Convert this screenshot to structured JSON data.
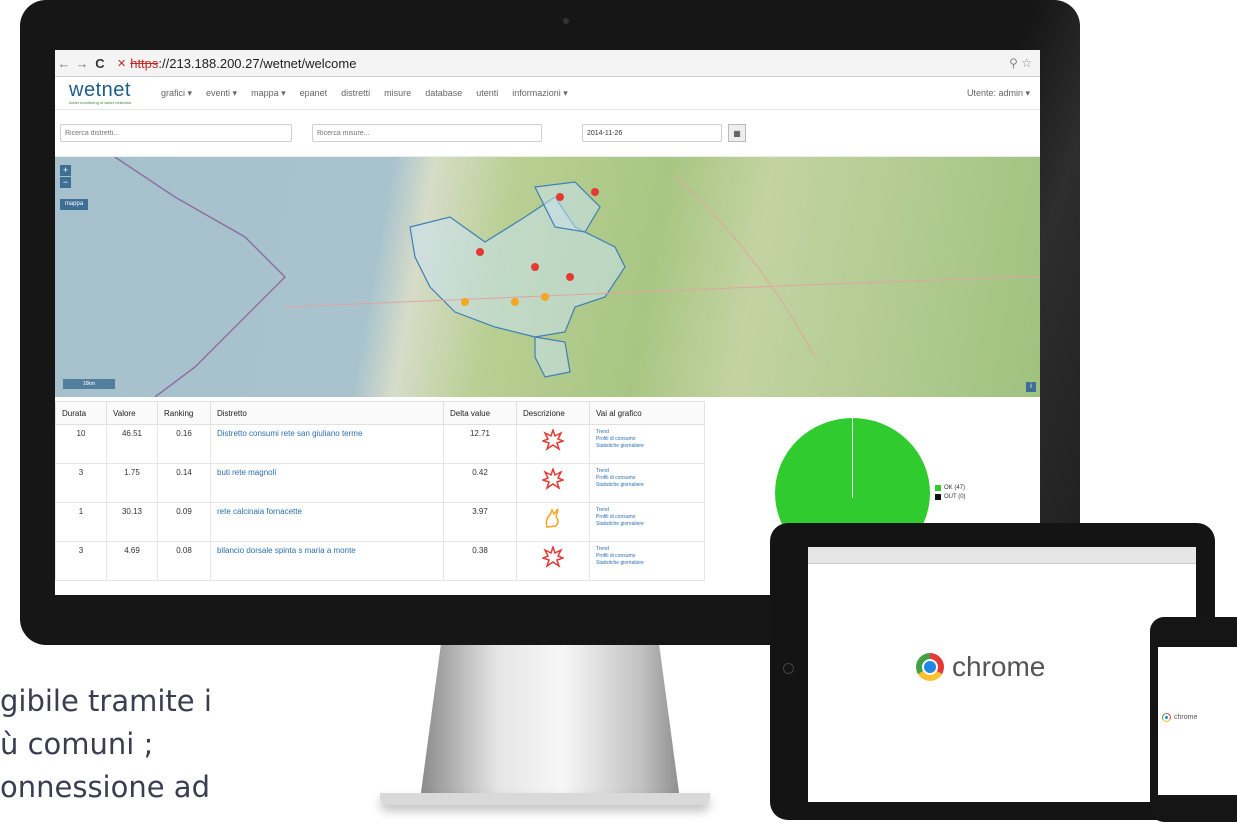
{
  "browser": {
    "url_protocol": "https",
    "url_rest": "://213.188.200.27/wetnet/welcome"
  },
  "app": {
    "logo_text": "wetnet",
    "logo_tagline": "smart monitoring of water networks",
    "menu": [
      "grafici ▾",
      "eventi ▾",
      "mappa ▾",
      "epanet",
      "distretti",
      "misure",
      "database",
      "utenti",
      "informazioni ▾"
    ],
    "user_label": "Utente: admin ▾"
  },
  "search": {
    "districts_placeholder": "Ricerca distretti...",
    "measures_placeholder": "Ricerca misure...",
    "date_value": "2014-11-26"
  },
  "map": {
    "zoom_in": "+",
    "zoom_out": "−",
    "layer_button": "mappa",
    "scale_label": "10km"
  },
  "table": {
    "headers": [
      "Durata",
      "Valore",
      "Ranking",
      "Distretto",
      "Delta value",
      "Descrizione",
      "Vai al grafico"
    ],
    "chart_links": [
      "Trend",
      "Profili di consumo",
      "Statistiche giornaliere"
    ],
    "rows": [
      {
        "durata": "10",
        "valore": "46.51",
        "ranking": "0.16",
        "distretto": "Distretto consumi rete san giuliano terme",
        "delta": "12.71",
        "icon": "burst-icon"
      },
      {
        "durata": "3",
        "valore": "1.75",
        "ranking": "0.14",
        "distretto": "buti rete magnoli",
        "delta": "0.42",
        "icon": "burst-icon"
      },
      {
        "durata": "1",
        "valore": "30.13",
        "ranking": "0.09",
        "distretto": "rete calcinaia fornacette",
        "delta": "3.97",
        "icon": "leak-icon"
      },
      {
        "durata": "3",
        "valore": "4.69",
        "ranking": "0.08",
        "distretto": "bilancio dorsale spinta s maria a monte",
        "delta": "0.38",
        "icon": "burst-icon"
      }
    ]
  },
  "pie": {
    "legend": [
      {
        "label": "OK (47)",
        "color": "#2fcb2f",
        "value": 47
      },
      {
        "label": "OUT (0)",
        "color": "#111111",
        "value": 0
      }
    ]
  },
  "tablet": {
    "brand": "chrome"
  },
  "phone": {
    "brand": "chrome"
  },
  "slide": {
    "line1": "gibile tramite i",
    "line2": "ù comuni ;",
    "line3": "onnessione ad"
  },
  "colors": {
    "accent": "#1d5e8a",
    "link": "#2a6fb0",
    "alert": "#c62828"
  }
}
